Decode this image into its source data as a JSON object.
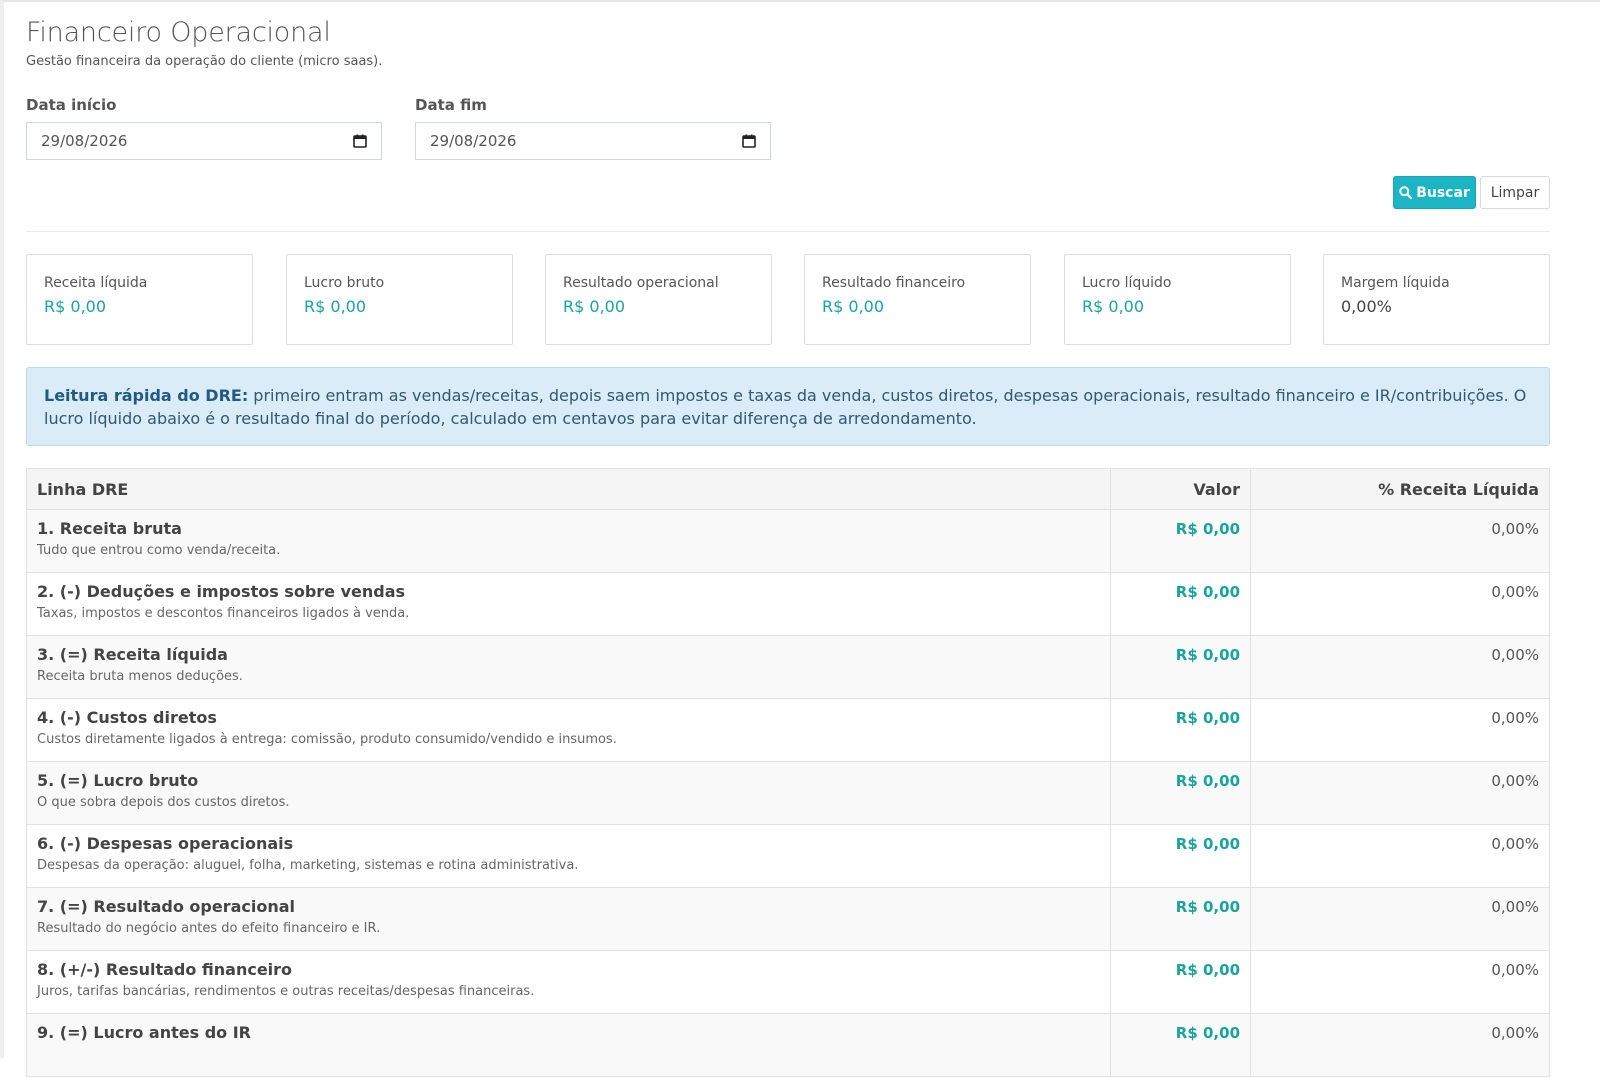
{
  "header": {
    "title": "Financeiro Operacional",
    "subtitle": "Gestão financeira da operação do cliente (micro saas)."
  },
  "filters": {
    "start_label": "Data início",
    "start_value": "29/08/2026",
    "end_label": "Data fim",
    "end_value": "29/08/2026",
    "search_label": "Buscar",
    "clear_label": "Limpar"
  },
  "colors": {
    "accent": "#1bb5c6",
    "value_green": "#1aa59a",
    "info_bg": "#d9ecf7"
  },
  "cards": [
    {
      "label": "Receita líquida",
      "value": "R$ 0,00"
    },
    {
      "label": "Lucro bruto",
      "value": "R$ 0,00"
    },
    {
      "label": "Resultado operacional",
      "value": "R$ 0,00"
    },
    {
      "label": "Resultado financeiro",
      "value": "R$ 0,00"
    },
    {
      "label": "Lucro líquido",
      "value": "R$ 0,00"
    },
    {
      "label": "Margem líquida",
      "value": "0,00%"
    }
  ],
  "info": {
    "bold": "Leitura rápida do DRE:",
    "text": " primeiro entram as vendas/receitas, depois saem impostos e taxas da venda, custos diretos, despesas operacionais, resultado financeiro e IR/contribuições. O lucro líquido abaixo é o resultado final do período, calculado em centavos para evitar diferença de arredondamento."
  },
  "table": {
    "headers": [
      "Linha DRE",
      "Valor",
      "% Receita Líquida"
    ],
    "rows": [
      {
        "title": "1. Receita bruta",
        "desc": "Tudo que entrou como venda/receita.",
        "value": "R$ 0,00",
        "pct": "0,00%"
      },
      {
        "title": "2. (-) Deduções e impostos sobre vendas",
        "desc": "Taxas, impostos e descontos financeiros ligados à venda.",
        "value": "R$ 0,00",
        "pct": "0,00%"
      },
      {
        "title": "3. (=) Receita líquida",
        "desc": "Receita bruta menos deduções.",
        "value": "R$ 0,00",
        "pct": "0,00%"
      },
      {
        "title": "4. (-) Custos diretos",
        "desc": "Custos diretamente ligados à entrega: comissão, produto consumido/vendido e insumos.",
        "value": "R$ 0,00",
        "pct": "0,00%"
      },
      {
        "title": "5. (=) Lucro bruto",
        "desc": "O que sobra depois dos custos diretos.",
        "value": "R$ 0,00",
        "pct": "0,00%"
      },
      {
        "title": "6. (-) Despesas operacionais",
        "desc": "Despesas da operação: aluguel, folha, marketing, sistemas e rotina administrativa.",
        "value": "R$ 0,00",
        "pct": "0,00%"
      },
      {
        "title": "7. (=) Resultado operacional",
        "desc": "Resultado do negócio antes do efeito financeiro e IR.",
        "value": "R$ 0,00",
        "pct": "0,00%"
      },
      {
        "title": "8. (+/-) Resultado financeiro",
        "desc": "Juros, tarifas bancárias, rendimentos e outras receitas/despesas financeiras.",
        "value": "R$ 0,00",
        "pct": "0,00%"
      },
      {
        "title": "9. (=) Lucro antes do IR",
        "desc": "",
        "value": "R$ 0,00",
        "pct": "0,00%"
      }
    ]
  }
}
